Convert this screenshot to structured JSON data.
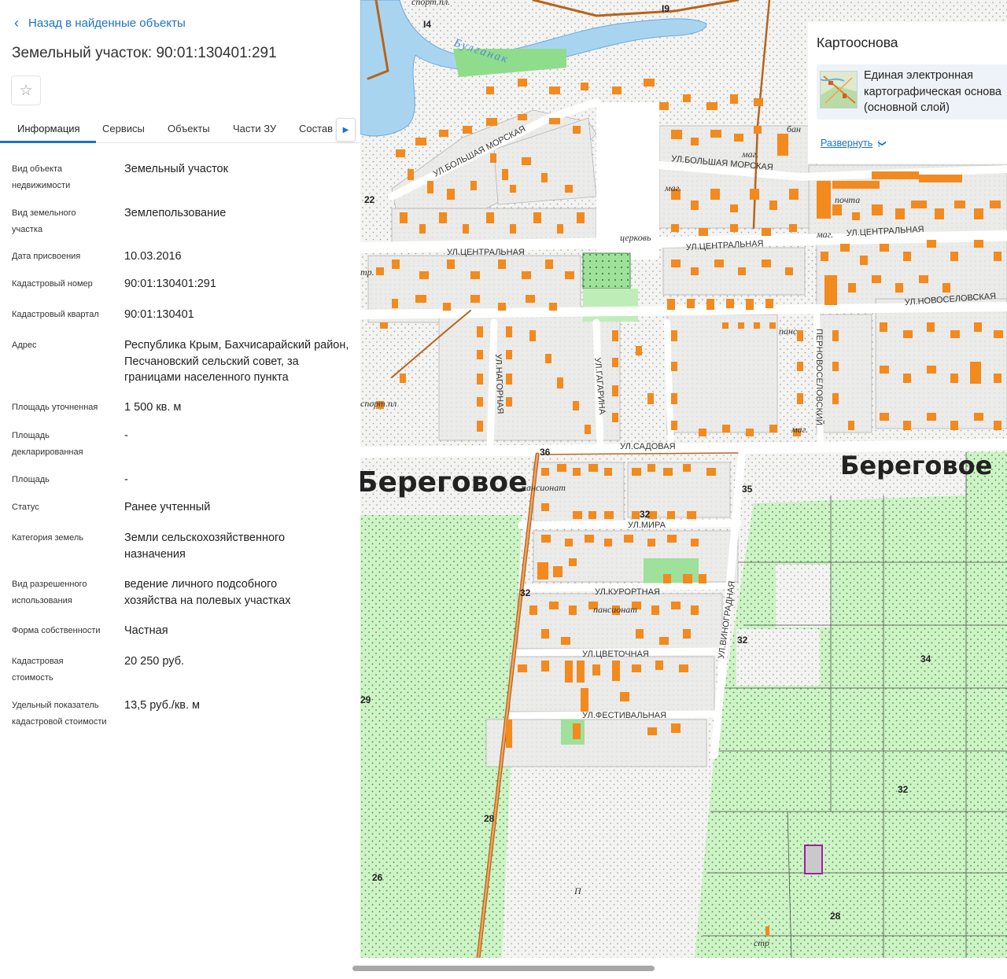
{
  "nav": {
    "back_label": "Назад в найденные объекты"
  },
  "object": {
    "title": "Земельный участок: 90:01:130401:291"
  },
  "tabs": [
    {
      "label": "Информация",
      "active": true
    },
    {
      "label": "Сервисы"
    },
    {
      "label": "Объекты"
    },
    {
      "label": "Части ЗУ"
    },
    {
      "label": "Состав"
    }
  ],
  "info": [
    {
      "key": "Вид объекта недвижимости",
      "value": "Земельный участок"
    },
    {
      "key": "Вид земельного участка",
      "value": "Землепользование"
    },
    {
      "key": "Дата присвоения",
      "value": "10.03.2016"
    },
    {
      "key": "Кадастровый номер",
      "value": "90:01:130401:291"
    },
    {
      "key": "Кадастровый квартал",
      "value": "90:01:130401"
    },
    {
      "key": "Адрес",
      "value": "Республика Крым, Бахчисарайский район, Песчановский сельский совет, за границами населенного пункта"
    },
    {
      "key": "Площадь уточненная",
      "value": "1 500 кв. м"
    },
    {
      "key": "Площадь декларированная",
      "value": "-"
    },
    {
      "key": "Площадь",
      "value": "-"
    },
    {
      "key": "Статус",
      "value": "Ранее учтенный"
    },
    {
      "key": "Категория земель",
      "value": "Земли сельскохозяйственного назначения"
    },
    {
      "key": "Вид разрешенного использования",
      "value": "ведение личного подсобного хозяйства на полевых участках"
    },
    {
      "key": "Форма собственности",
      "value": "Частная"
    },
    {
      "key": "Кадастровая стоимость",
      "value": "20 250 руб."
    },
    {
      "key": "Удельный показатель кадастровой стоимости",
      "value": "13,5 руб./кв. м"
    }
  ],
  "basemap": {
    "title": "Картооснова",
    "layer_name": "Единая электронная картографическая основа (основной слой)",
    "layer_line1": "Единая электронная",
    "layer_line2": "картографическая основа",
    "layer_line3": "(основной слой)",
    "expand_label": "Развернуть"
  },
  "map": {
    "settlement": "Береговое",
    "river": "Булганак",
    "streets": {
      "morskaya": "УЛ.БОЛЬШАЯ МОРСКАЯ",
      "tsentralnaya": "УЛ.ЦЕНТРАЛЬНАЯ",
      "novoselovskaya": "УЛ.НОВОСЕЛОВСКАЯ",
      "pervonovoselovsky": "ПЕРНОВОСЕЛОВСКИЙ",
      "nagornaya": "УЛ.НАГОРНАЯ",
      "gagarina": "УЛ.ГАГАРИНА",
      "sadovaya": "УЛ.САДОВАЯ",
      "mira": "УЛ.МИРА",
      "kurortnaya": "УЛ.КУРОРТНАЯ",
      "tsvetochnaya": "УЛ.ЦВЕТОЧНАЯ",
      "festivalnaya": "УЛ.ФЕСТИВАЛЬНАЯ",
      "vinogradnaya": "УЛ.ВИНОГРАДНАЯ"
    },
    "poi": {
      "church": "церковь",
      "post": "почта",
      "shop": "маг.",
      "pension": "пансионат",
      "pans_short": "панс",
      "sport": "спорт.пл.",
      "sport_short": "спорт.пл",
      "bath": "бан",
      "str": "стр",
      "tp": "тр.",
      "p": "П"
    },
    "numbers": [
      "I4",
      "I9",
      "22",
      "36",
      "35",
      "32",
      "32",
      "32",
      "34",
      "32",
      "29",
      "28",
      "26",
      "28"
    ]
  }
}
